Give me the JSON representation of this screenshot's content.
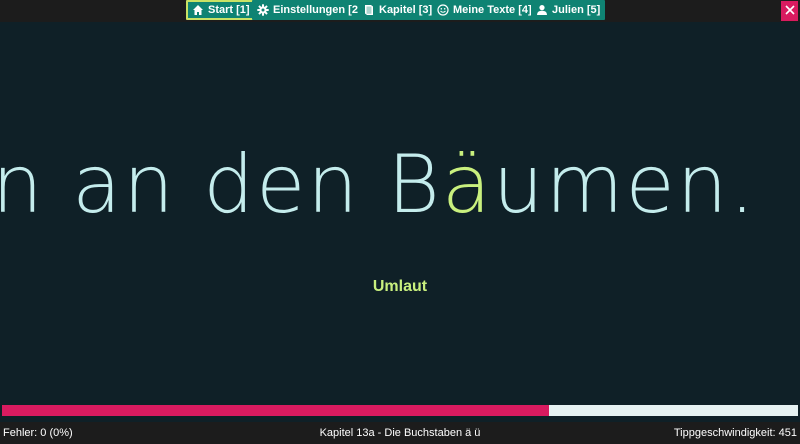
{
  "nav": {
    "items": [
      {
        "label": "Start [1]",
        "icon": "home-icon"
      },
      {
        "label": "Einstellungen [2]",
        "icon": "gear-icon"
      },
      {
        "label": "Kapitel [3]",
        "icon": "book-icon"
      },
      {
        "label": "Meine Texte [4]",
        "icon": "smiley-icon"
      },
      {
        "label": "Julien [5]",
        "icon": "user-icon"
      }
    ],
    "active_index": 0,
    "close_icon": "close-icon"
  },
  "exercise": {
    "typed_text": "n an den B",
    "current_char": "ä",
    "remaining_text": "umen.",
    "hint": "Umlaut"
  },
  "progress": {
    "fraction": 0.687
  },
  "status": {
    "errors": "Fehler: 0 (0%)",
    "chapter": "Kapitel 13a - Die Buchstaben ä ü",
    "speed": "Tippgeschwindigkeit: 451"
  },
  "colors": {
    "background": "#0f2027",
    "nav_button": "#0f8373",
    "active_border": "#c9e265",
    "text": "#c4ecec",
    "highlight": "#c9f07e",
    "progress_fill": "#d81b60",
    "progress_track": "#e6f2f2",
    "close_button": "#d81b60"
  }
}
